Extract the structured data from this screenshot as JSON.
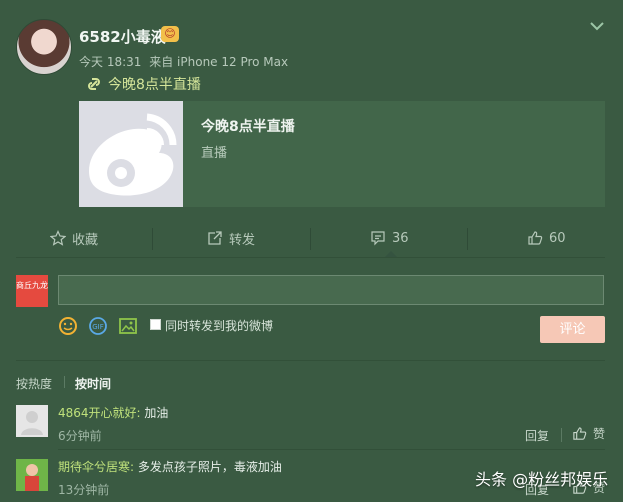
{
  "post": {
    "username": "6582小毒液",
    "vip_badge": "vip-emoji",
    "time": "今天 18:31",
    "source": "来自 iPhone 12 Pro Max",
    "link_text": "今晚8点半直播",
    "card": {
      "title": "今晚8点半直播",
      "subtitle": "直播",
      "thumb_icon": "weibo-logo-icon"
    }
  },
  "actions": {
    "favorite": "收藏",
    "repost": "转发",
    "comments": "36",
    "likes": "60"
  },
  "composer": {
    "brand_label": "商丘九龙",
    "placeholder": "",
    "checkbox_label": "同时转发到我的微博",
    "submit_label": "评论"
  },
  "sort": {
    "by_hot": "按热度",
    "by_time": "按时间"
  },
  "comments": [
    {
      "user": "4864开心就好:",
      "text": "加油",
      "time": "6分钟前",
      "reply": "回复",
      "like": "赞"
    },
    {
      "user": "期待伞兮居寒:",
      "text": "多发点孩子照片，毒液加油",
      "time": "13分钟前",
      "reply": "回复",
      "like": "赞"
    }
  ],
  "watermark": "头条 @粉丝邦娱乐",
  "colors": {
    "background": "#3a5a42",
    "card": "#42664a",
    "link": "#d5e59a",
    "username_accent": "#bfe17b",
    "submit": "#f6c8b6"
  }
}
